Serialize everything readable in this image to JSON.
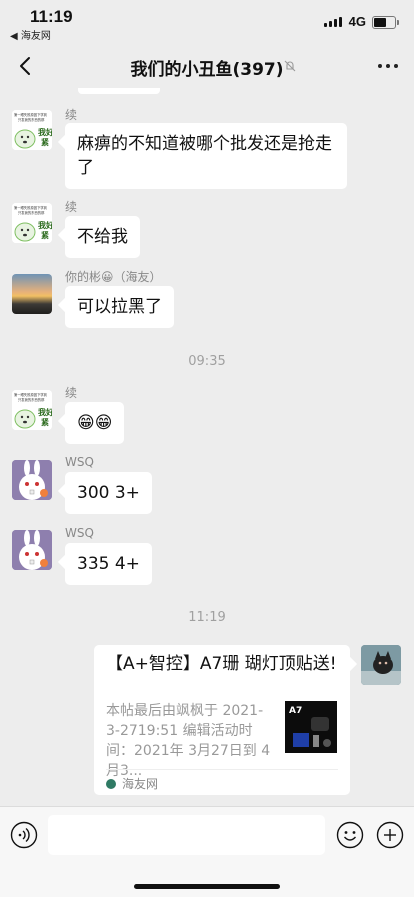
{
  "status_bar": {
    "time": "11:19",
    "back_app": "◀ 海友网",
    "network": "4G"
  },
  "header": {
    "title": "我们的小丑鱼(397)"
  },
  "messages": [
    {
      "sender": "续",
      "text": "麻痹的不知道被哪个批发还是抢走了"
    },
    {
      "sender": "续",
      "text": "不给我"
    },
    {
      "sender": "你的彬😀（海友）",
      "text": "可以拉黑了"
    },
    {
      "timestamp": "09:35"
    },
    {
      "sender": "续",
      "text": "😁😁"
    },
    {
      "sender": "WSQ",
      "text": "300  3+"
    },
    {
      "sender": "WSQ",
      "text": "335  4+"
    },
    {
      "timestamp": "11:19"
    }
  ],
  "link_card": {
    "title": "【A+智控】A7珊 瑚灯顶贴送!",
    "description": "本帖最后由飒枫于 2021-3-2719:51 编辑活动时间：2021年 3月27日到 4月3...",
    "thumb_text": "A7",
    "source": "海友网"
  },
  "sticker": {
    "line1": "第一眼失败原因下学到",
    "line2": "只发我的东西的那",
    "big": "我好\n紧"
  },
  "icons": {
    "back": "chevron-left-icon",
    "mute": "bell-muted-icon",
    "more": "more-dots-icon",
    "voice": "voice-icon",
    "emoji": "emoji-icon",
    "add": "plus-icon"
  }
}
